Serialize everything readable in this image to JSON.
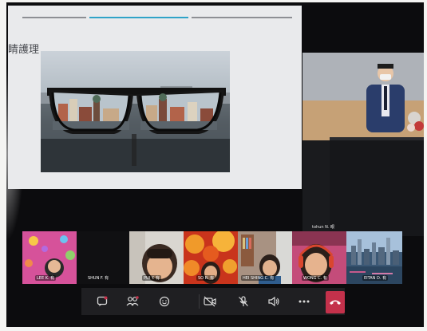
{
  "window": {
    "title": ""
  },
  "slide": {
    "title": "睛護理"
  },
  "presenter": {
    "name": "tohun N. 眼"
  },
  "participants": [
    {
      "name": "LEE K. 有"
    },
    {
      "name": "SHUN F. 有"
    },
    {
      "name": "PUI Y. 有"
    },
    {
      "name": "SO R. 有"
    },
    {
      "name": "HEI SHING C. 有"
    },
    {
      "name": "WONG C. 有"
    },
    {
      "name": "EITAN D. 有"
    }
  ],
  "controls": {
    "icons": [
      "chat-icon",
      "people-icon",
      "reactions-icon",
      "camera-off-icon",
      "mic-off-icon",
      "speaker-icon",
      "more-icon",
      "hang-up-icon"
    ]
  },
  "colors": {
    "accent": "#2fa3c8",
    "leave": "#c4314b",
    "control_bar": "#1f1f22"
  }
}
